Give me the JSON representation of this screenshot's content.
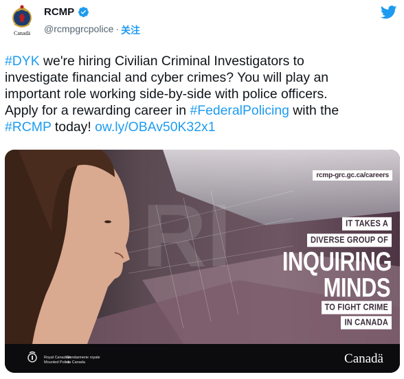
{
  "header": {
    "display_name": "RCMP",
    "handle": "@rcmpgrcpolice",
    "separator": "·",
    "follow_label": "关注",
    "avatar_caption": "Canadä",
    "verified_icon": "verified-badge-icon",
    "platform_icon": "twitter-bird-icon"
  },
  "tweet": {
    "line1_pre": "",
    "hashtag_dyk": "#DYK",
    "line1_post": " we're hiring Civilian Criminal Investigators to",
    "line2": "investigate financial and cyber crimes? You will play an",
    "line3": "important role working side-by-side with police officers.",
    "line4_pre": "Apply for a rewarding career in ",
    "hashtag_federal": "#FederalPolicing",
    "line4_post": " with the",
    "hashtag_rcmp": "#RCMP",
    "line5_mid": " today! ",
    "short_link": "ow.ly/OBAv50K32x1"
  },
  "media": {
    "url_badge": "rcmp-grc.gc.ca/careers",
    "tag1": "IT TAKES A",
    "tag2": "DIVERSE GROUP OF",
    "headline1": "INQUIRING",
    "headline2": "MINDS",
    "tag3": "TO FIGHT CRIME",
    "tag4": "IN CANADA",
    "org_en_1": "Royal Canadian",
    "org_en_2": "Mounted Police",
    "org_fr_1": "Gendarmerie royale",
    "org_fr_2": "du Canada",
    "canada_wordmark": "Canadä"
  },
  "colors": {
    "link": "#1d9bf0",
    "text": "#0f1419",
    "muted": "#536471"
  }
}
